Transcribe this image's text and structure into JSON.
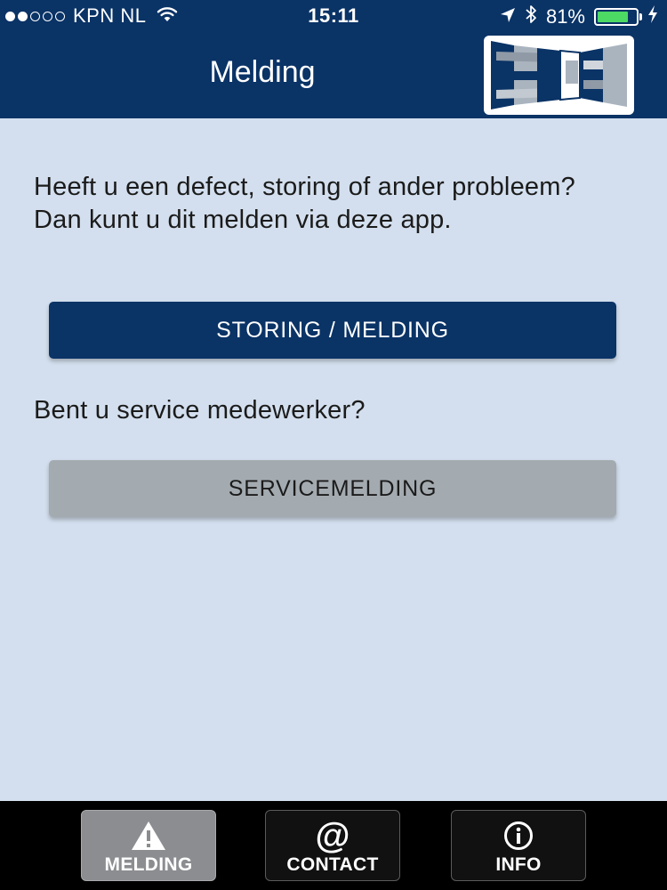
{
  "status_bar": {
    "carrier": "KPN NL",
    "time": "15:11",
    "battery_percent": "81%",
    "battery_level": 0.81,
    "signal_dots_filled": 2,
    "signal_dots_total": 5
  },
  "header": {
    "title": "Melding",
    "logo_icon": "company-logo"
  },
  "main": {
    "intro_text": "Heeft u een defect, storing of ander probleem? Dan kunt u dit melden via deze app.",
    "primary_button_label": "STORING / MELDING",
    "question_text": "Bent u service medewerker?",
    "secondary_button_label": "SERVICEMELDING"
  },
  "tabbar": {
    "tabs": [
      {
        "label": "MELDING",
        "icon": "warning-icon",
        "active": true
      },
      {
        "label": "CONTACT",
        "icon": "at-icon",
        "active": false
      },
      {
        "label": "INFO",
        "icon": "info-icon",
        "active": false
      }
    ]
  },
  "colors": {
    "brand_navy": "#0a3366",
    "background": "#d3dfee",
    "secondary_button": "#a4abb0",
    "battery_green": "#4cd964",
    "tabbar": "#000000"
  }
}
